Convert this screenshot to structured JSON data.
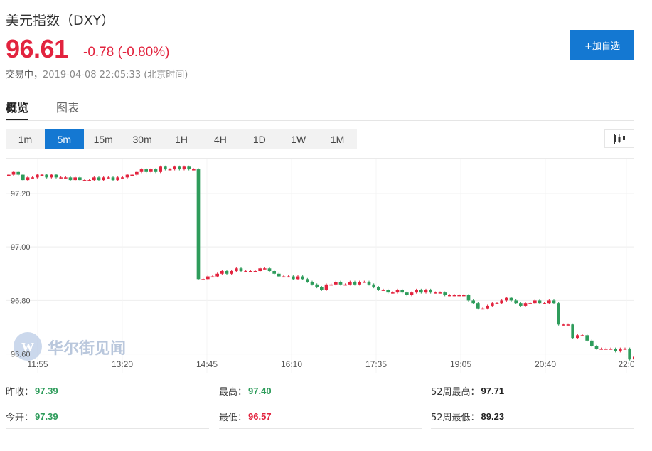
{
  "header": {
    "title": "美元指数（DXY）",
    "price": "96.61",
    "change": "-0.78 (-0.80%)",
    "status_label": "交易中，",
    "status_time": "2019-04-08 22:05:33 (北京时间)",
    "add_button": "+加自选"
  },
  "tabs": [
    {
      "label": "概览",
      "active": true
    },
    {
      "label": "图表",
      "active": false
    }
  ],
  "periods": [
    {
      "label": "1m",
      "active": false
    },
    {
      "label": "5m",
      "active": true
    },
    {
      "label": "15m",
      "active": false
    },
    {
      "label": "30m",
      "active": false
    },
    {
      "label": "1H",
      "active": false
    },
    {
      "label": "4H",
      "active": false
    },
    {
      "label": "1D",
      "active": false
    },
    {
      "label": "1W",
      "active": false
    },
    {
      "label": "1M",
      "active": false
    }
  ],
  "chart_type_icon": "candlestick-icon",
  "watermark": "华尔街见闻",
  "colors": {
    "up": "#e2233e",
    "down": "#2e9c5b",
    "accent": "#1478d2",
    "grid": "#eeeeee"
  },
  "chart_data": {
    "type": "candlestick",
    "y_ticks": [
      "97.20",
      "97.00",
      "96.80",
      "96.60"
    ],
    "x_ticks": [
      "11:55",
      "13:20",
      "14:45",
      "16:10",
      "17:35",
      "19:05",
      "20:40",
      "22:0"
    ],
    "ylim": [
      96.53,
      97.33
    ],
    "xlim": [
      0,
      132
    ],
    "grid": true,
    "candles": [
      [
        97.27,
        97.27
      ],
      [
        97.27,
        97.28
      ],
      [
        97.28,
        97.27
      ],
      [
        97.27,
        97.25
      ],
      [
        97.25,
        97.26
      ],
      [
        97.26,
        97.26
      ],
      [
        97.26,
        97.27
      ],
      [
        97.27,
        97.27
      ],
      [
        97.27,
        97.26
      ],
      [
        97.26,
        97.27
      ],
      [
        97.27,
        97.26
      ],
      [
        97.26,
        97.26
      ],
      [
        97.26,
        97.26
      ],
      [
        97.26,
        97.25
      ],
      [
        97.25,
        97.26
      ],
      [
        97.26,
        97.25
      ],
      [
        97.25,
        97.25
      ],
      [
        97.25,
        97.25
      ],
      [
        97.25,
        97.26
      ],
      [
        97.26,
        97.25
      ],
      [
        97.25,
        97.26
      ],
      [
        97.26,
        97.26
      ],
      [
        97.26,
        97.25
      ],
      [
        97.25,
        97.26
      ],
      [
        97.26,
        97.26
      ],
      [
        97.26,
        97.27
      ],
      [
        97.27,
        97.27
      ],
      [
        97.27,
        97.28
      ],
      [
        97.28,
        97.29
      ],
      [
        97.29,
        97.28
      ],
      [
        97.28,
        97.29
      ],
      [
        97.29,
        97.28
      ],
      [
        97.28,
        97.3
      ],
      [
        97.3,
        97.29
      ],
      [
        97.29,
        97.29
      ],
      [
        97.29,
        97.3
      ],
      [
        97.3,
        97.29
      ],
      [
        97.29,
        97.3
      ],
      [
        97.3,
        97.29
      ],
      [
        97.29,
        97.29
      ],
      [
        97.29,
        96.88
      ],
      [
        96.88,
        96.88
      ],
      [
        96.88,
        96.89
      ],
      [
        96.89,
        96.89
      ],
      [
        96.89,
        96.9
      ],
      [
        96.9,
        96.91
      ],
      [
        96.91,
        96.9
      ],
      [
        96.9,
        96.91
      ],
      [
        96.91,
        96.92
      ],
      [
        96.92,
        96.91
      ],
      [
        96.91,
        96.91
      ],
      [
        96.91,
        96.91
      ],
      [
        96.91,
        96.91
      ],
      [
        96.91,
        96.92
      ],
      [
        96.92,
        96.92
      ],
      [
        96.92,
        96.91
      ],
      [
        96.91,
        96.9
      ],
      [
        96.9,
        96.89
      ],
      [
        96.89,
        96.89
      ],
      [
        96.89,
        96.89
      ],
      [
        96.89,
        96.88
      ],
      [
        96.88,
        96.89
      ],
      [
        96.89,
        96.88
      ],
      [
        96.88,
        96.87
      ],
      [
        96.87,
        96.86
      ],
      [
        96.86,
        96.85
      ],
      [
        96.85,
        96.84
      ],
      [
        96.84,
        96.86
      ],
      [
        96.86,
        96.86
      ],
      [
        96.86,
        96.87
      ],
      [
        96.87,
        96.86
      ],
      [
        96.86,
        96.86
      ],
      [
        96.86,
        96.87
      ],
      [
        96.87,
        96.86
      ],
      [
        96.86,
        96.87
      ],
      [
        96.87,
        96.87
      ],
      [
        96.87,
        96.86
      ],
      [
        96.86,
        96.85
      ],
      [
        96.85,
        96.84
      ],
      [
        96.84,
        96.84
      ],
      [
        96.84,
        96.83
      ],
      [
        96.83,
        96.83
      ],
      [
        96.83,
        96.84
      ],
      [
        96.84,
        96.83
      ],
      [
        96.83,
        96.82
      ],
      [
        96.82,
        96.83
      ],
      [
        96.83,
        96.84
      ],
      [
        96.84,
        96.83
      ],
      [
        96.83,
        96.84
      ],
      [
        96.84,
        96.83
      ],
      [
        96.83,
        96.83
      ],
      [
        96.83,
        96.83
      ],
      [
        96.83,
        96.82
      ],
      [
        96.82,
        96.82
      ],
      [
        96.82,
        96.82
      ],
      [
        96.82,
        96.82
      ],
      [
        96.82,
        96.82
      ],
      [
        96.82,
        96.8
      ],
      [
        96.8,
        96.79
      ],
      [
        96.79,
        96.77
      ],
      [
        96.77,
        96.77
      ],
      [
        96.77,
        96.78
      ],
      [
        96.78,
        96.79
      ],
      [
        96.79,
        96.79
      ],
      [
        96.79,
        96.8
      ],
      [
        96.8,
        96.81
      ],
      [
        96.81,
        96.8
      ],
      [
        96.8,
        96.79
      ],
      [
        96.79,
        96.78
      ],
      [
        96.78,
        96.79
      ],
      [
        96.79,
        96.79
      ],
      [
        96.79,
        96.8
      ],
      [
        96.8,
        96.79
      ],
      [
        96.79,
        96.79
      ],
      [
        96.79,
        96.8
      ],
      [
        96.8,
        96.79
      ],
      [
        96.79,
        96.71
      ],
      [
        96.71,
        96.71
      ],
      [
        96.71,
        96.71
      ],
      [
        96.71,
        96.66
      ],
      [
        96.66,
        96.67
      ],
      [
        96.67,
        96.67
      ],
      [
        96.67,
        96.65
      ],
      [
        96.65,
        96.63
      ],
      [
        96.63,
        96.62
      ],
      [
        96.62,
        96.62
      ],
      [
        96.62,
        96.62
      ],
      [
        96.62,
        96.62
      ],
      [
        96.62,
        96.61
      ],
      [
        96.61,
        96.62
      ],
      [
        96.62,
        96.62
      ],
      [
        96.62,
        96.58
      ],
      [
        96.58,
        96.59
      ],
      [
        96.59,
        96.62
      ]
    ]
  },
  "stats": [
    [
      {
        "label": "昨收：",
        "value": "97.39",
        "color": "green"
      },
      {
        "label": "最高：",
        "value": "97.40",
        "color": "green"
      },
      {
        "label": "52周最高：",
        "value": "97.71",
        "color": "dark"
      }
    ],
    [
      {
        "label": "今开：",
        "value": "97.39",
        "color": "green"
      },
      {
        "label": "最低：",
        "value": "96.57",
        "color": "red"
      },
      {
        "label": "52周最低：",
        "value": "89.23",
        "color": "dark"
      }
    ]
  ]
}
